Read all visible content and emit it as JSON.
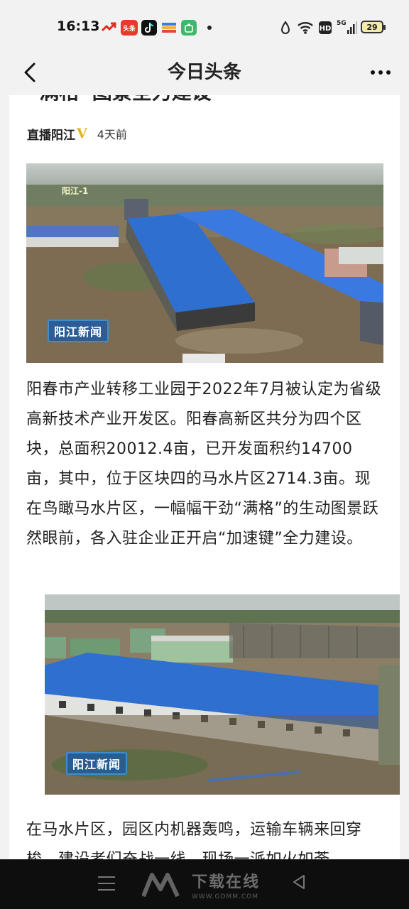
{
  "status_bar": {
    "time": "16:13",
    "apps": [
      "pinduoduo-icon",
      "toutiao-icon",
      "tiktok-icon",
      "wallet-icon",
      "app-store-icon"
    ],
    "app_labels": {
      "toutiao": "头条"
    },
    "network": "5G",
    "battery": "29"
  },
  "header": {
    "title": "今日头条"
  },
  "article": {
    "title_fragment": "“满格”图景全力建设",
    "author": "直播阳江",
    "verified_mark": "V",
    "time_ago": "4天前",
    "image1": {
      "channel_logo": "阳江-1",
      "overlay_label": "阳江新闻"
    },
    "paragraph1": "阳春市产业转移工业园于2022年7月被认定为省级高新技术产业开发区。阳春高新区共分为四个区块，总面积20012.4亩，已开发面积约14700亩，其中，位于区块四的马水片区2714.3亩。现在鸟瞰马水片区，一幅幅干劲“满格”的生动图景跃然眼前，各入驻企业正开启“加速键”全力建设。",
    "image2": {
      "overlay_label": "阳江新闻"
    },
    "paragraph2": "在马水片区，园区内机器轰鸣，运输车辆来回穿梭，建设者们奋战一线，现场一派如火如荼"
  },
  "watermark": {
    "text": "下载在线",
    "url": "WWW.GDMM.COM"
  },
  "colors": {
    "roof_blue": "#2f6fd0",
    "verified_gold": "#e3b419",
    "nav_bg": "#0e0e0e"
  }
}
